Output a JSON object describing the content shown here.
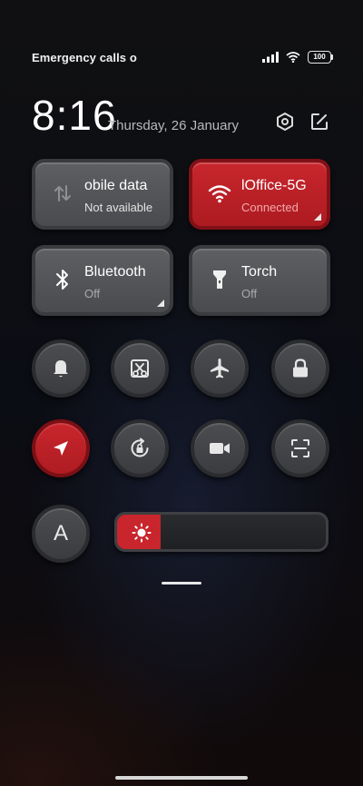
{
  "status_bar": {
    "carrier_text": "Emergency calls o",
    "battery_level": "100"
  },
  "header": {
    "time": "8:16",
    "date": "Thursday, 26 January"
  },
  "tiles": {
    "mobile_data": {
      "title": "obile data",
      "subtitle": "Not available"
    },
    "wifi": {
      "title": "lOffice-5G",
      "subtitle": "Connected"
    },
    "bluetooth": {
      "title": "Bluetooth",
      "subtitle": "Off"
    },
    "torch": {
      "title": "Torch",
      "subtitle": "Off"
    }
  },
  "round_buttons": {
    "auto_brightness_label": "A"
  },
  "brightness": {
    "level_percent": 21
  },
  "colors": {
    "accent_red": "#c8262d",
    "tile_gray": "#55565a"
  }
}
